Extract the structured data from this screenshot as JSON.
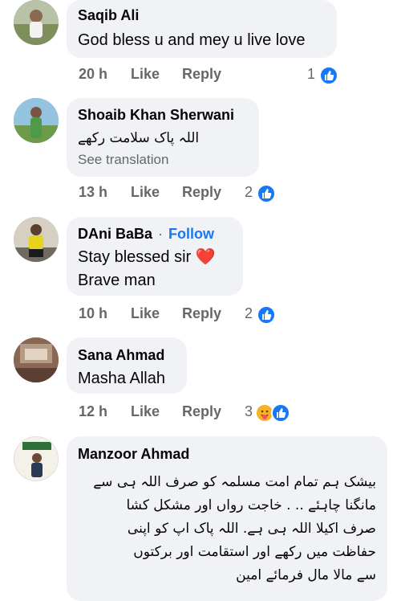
{
  "comments": [
    {
      "name": "Saqib Ali",
      "text": "God bless u and mey u live love",
      "time": "20 h",
      "like": "Like",
      "reply": "Reply",
      "reactions": "1"
    },
    {
      "name": "Shoaib Khan Sherwani",
      "text": "اللہ پاک سلامت رکھے",
      "see_translation": "See translation",
      "time": "13 h",
      "like": "Like",
      "reply": "Reply",
      "reactions": "2"
    },
    {
      "name": "DAni BaBa",
      "follow": "Follow",
      "dot": "·",
      "text_line1": "Stay blessed sir ❤️",
      "text_line2": "Brave man",
      "time": "10 h",
      "like": "Like",
      "reply": "Reply",
      "reactions": "2"
    },
    {
      "name": "Sana Ahmad",
      "text": "Masha Allah",
      "time": "12 h",
      "like": "Like",
      "reply": "Reply",
      "reactions": "3"
    },
    {
      "name": "Manzoor Ahmad",
      "lines": [
        "بیشک ہم تمام امت مسلمہ کو صرف اللہ ہی سے",
        "مانگنا چاہئے .. . خاجت رواں اور مشکل کشا",
        "صرف اکیلا اللہ ہی ہے. اللہ پاک اپ کو اپنی",
        "حفاظت میں رکھے اور استقامت اور برکتوں",
        "سے مالا مال فرمائے امین"
      ]
    }
  ],
  "colors": {
    "bubble": "#f0f2f5",
    "meta": "#65676b",
    "link": "#1877f2"
  }
}
